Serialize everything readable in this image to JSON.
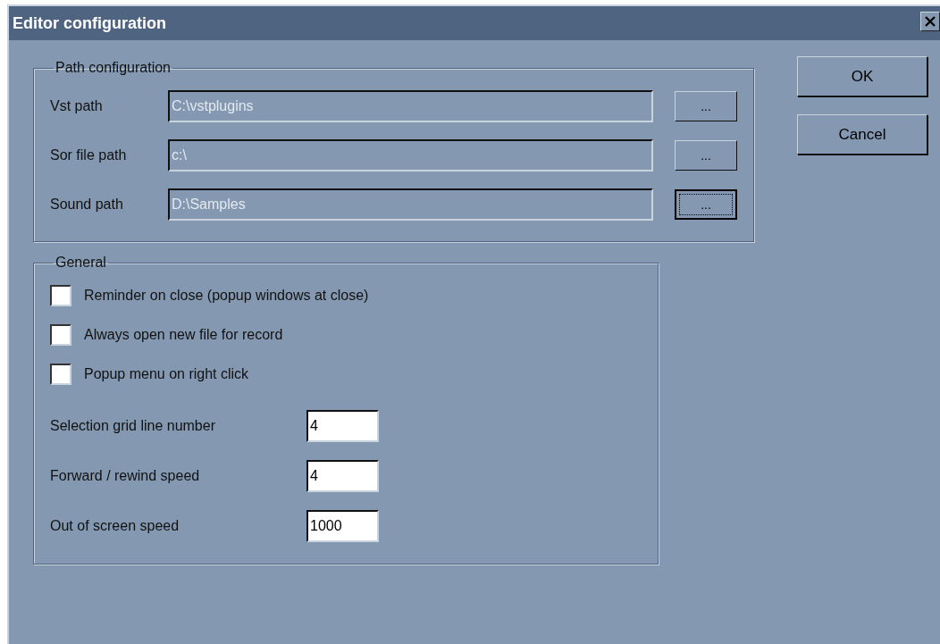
{
  "window": {
    "title": "Editor configuration"
  },
  "path_configuration": {
    "title": "Path configuration",
    "rows": [
      {
        "label": "Vst path",
        "value": "C:\\vstplugins",
        "disabled": true,
        "browse_label": "...",
        "focused": false
      },
      {
        "label": "Sor file path",
        "value": "c:\\",
        "disabled": true,
        "browse_label": "...",
        "focused": false
      },
      {
        "label": "Sound path",
        "value": "D:\\Samples",
        "disabled": true,
        "browse_label": "...",
        "focused": true
      }
    ]
  },
  "general": {
    "title": "General",
    "checkboxes": [
      {
        "label": "Reminder on close (popup windows at close)",
        "checked": false
      },
      {
        "label": "Always open new file for record",
        "checked": false
      },
      {
        "label": "Popup menu on right click",
        "checked": false
      }
    ],
    "fields": [
      {
        "label": "Selection grid line number",
        "value": "4"
      },
      {
        "label": "Forward / rewind speed",
        "value": "4"
      },
      {
        "label": "Out of screen speed",
        "value": "1000"
      }
    ]
  },
  "buttons": [
    {
      "label": "OK"
    },
    {
      "label": "Cancel"
    }
  ]
}
